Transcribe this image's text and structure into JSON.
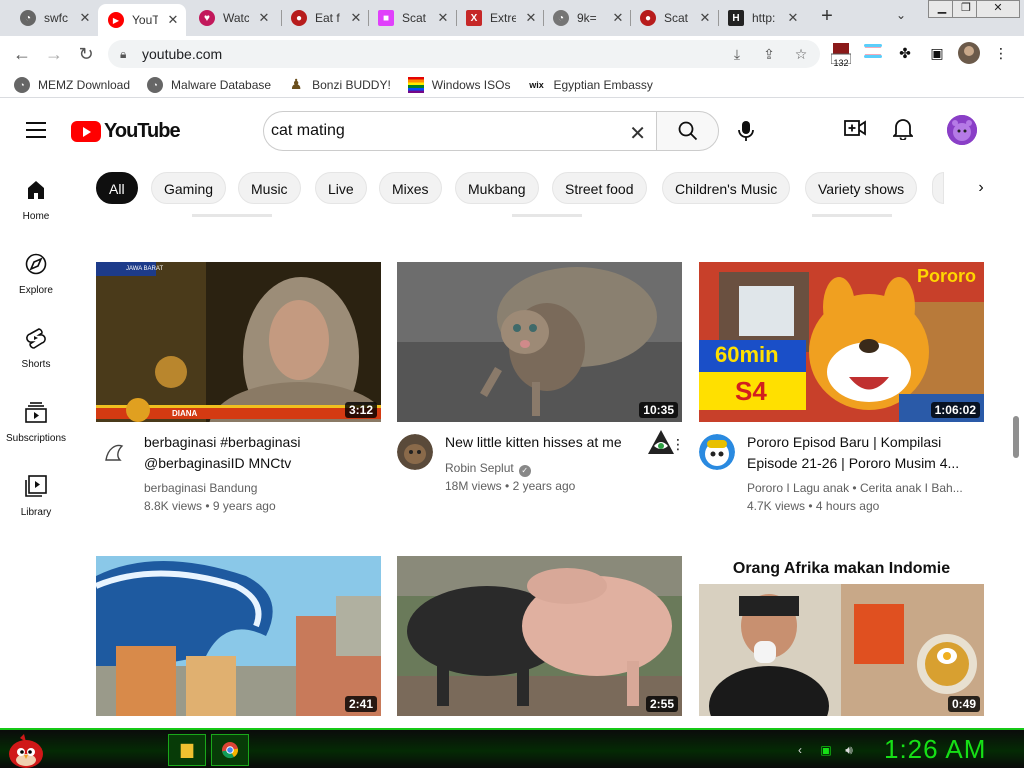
{
  "browser": {
    "tabs": [
      {
        "label": "swfc",
        "color": "#666666",
        "glyph": "◔"
      },
      {
        "label": "YouT",
        "color": "#ff0000",
        "glyph": "▶"
      },
      {
        "label": "Watc",
        "color": "#c2185b",
        "glyph": "♥"
      },
      {
        "label": "Eat f",
        "color": "#b71c1c",
        "glyph": "●"
      },
      {
        "label": "Scat",
        "color": "#e040fb",
        "glyph": "■"
      },
      {
        "label": "Extre",
        "color": "#c62828",
        "glyph": "X"
      },
      {
        "label": "9k=",
        "color": "#757575",
        "glyph": "◔"
      },
      {
        "label": "Scat",
        "color": "#b71c1c",
        "glyph": "●"
      },
      {
        "label": "http:",
        "color": "#222222",
        "glyph": "H"
      }
    ],
    "url": "youtube.com",
    "extension_badge": "132",
    "bookmarks": [
      {
        "label": "MEMZ Download",
        "glyph": "◔"
      },
      {
        "label": "Malware Database",
        "glyph": "◔"
      },
      {
        "label": "Bonzi BUDDY!",
        "glyph": "♟"
      },
      {
        "label": "Windows ISOs",
        "glyph": "▦"
      },
      {
        "label": "Egyptian Embassy",
        "glyph": "wix"
      }
    ]
  },
  "youtube": {
    "logo_text": "YouTube",
    "search_query": "cat mating",
    "chips": [
      "All",
      "Gaming",
      "Music",
      "Live",
      "Mixes",
      "Mukbang",
      "Street food",
      "Children's Music",
      "Variety shows"
    ],
    "nav": [
      {
        "label": "Home"
      },
      {
        "label": "Explore"
      },
      {
        "label": "Shorts"
      },
      {
        "label": "Subscriptions"
      },
      {
        "label": "Library"
      }
    ],
    "videos": [
      {
        "title": "berbaginasi #berbaginasi @berbaginasiID MNCtv",
        "channel": "berbaginasi Bandung",
        "views": "8.8K views",
        "age": "9 years ago",
        "duration": "3:12",
        "thumb_caption": "DIANA",
        "thumb_tag": "JAWA BARAT"
      },
      {
        "title": "New little kitten hisses at me",
        "channel": "Robin Seplut",
        "views": "18M views",
        "age": "2 years ago",
        "duration": "10:35"
      },
      {
        "title": "Pororo Episod Baru | Kompilasi Episode 21-26 | Pororo Musim 4...",
        "channel": "Pororo I Lagu anak",
        "channel_extra": "Cerita anak I Bah...",
        "views": "4.7K views",
        "age": "4 hours ago",
        "duration": "1:06:02",
        "thumb_badge_top": "60min",
        "thumb_badge_bottom": "S4",
        "thumb_logo": "Pororo"
      },
      {
        "duration": "2:41"
      },
      {
        "duration": "2:55"
      },
      {
        "duration": "0:49",
        "thumb_title": "Orang Afrika makan Indomie"
      }
    ],
    "meta_separator": "•"
  },
  "taskbar": {
    "clock": "1:26 AM"
  },
  "colors": {
    "accent_red": "#ff0000",
    "taskbar_green": "#16e016"
  }
}
